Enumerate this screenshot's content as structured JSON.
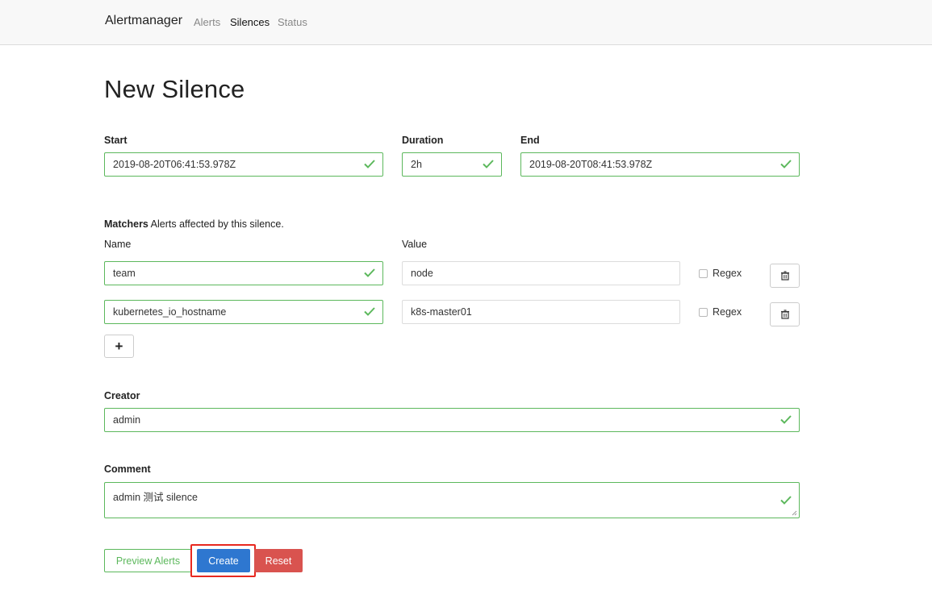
{
  "nav": {
    "brand": "Alertmanager",
    "links": [
      "Alerts",
      "Silences",
      "Status"
    ],
    "active": "Silences"
  },
  "page": {
    "title": "New Silence"
  },
  "form": {
    "start": {
      "label": "Start",
      "value": "2019-08-20T06:41:53.978Z"
    },
    "duration": {
      "label": "Duration",
      "value": "2h"
    },
    "end": {
      "label": "End",
      "value": "2019-08-20T08:41:53.978Z"
    },
    "matchers": {
      "title": "Matchers",
      "description": " Alerts affected by this silence.",
      "name_header": "Name",
      "value_header": "Value",
      "regex_label": "Regex",
      "rows": [
        {
          "name": "team",
          "value": "node",
          "regex": false
        },
        {
          "name": "kubernetes_io_hostname",
          "value": "k8s-master01",
          "regex": false
        }
      ],
      "add_button": "+"
    },
    "creator": {
      "label": "Creator",
      "value": "admin"
    },
    "comment": {
      "label": "Comment",
      "value": "admin 测试 silence"
    }
  },
  "actions": {
    "preview": "Preview Alerts",
    "create": "Create",
    "reset": "Reset"
  },
  "colors": {
    "valid": "#5cb85c",
    "primary": "#2e77d0",
    "danger": "#d9534f",
    "highlight": "#e8281f"
  },
  "icons": {
    "valid": "check-icon",
    "delete": "trash-icon",
    "add": "plus-icon"
  }
}
